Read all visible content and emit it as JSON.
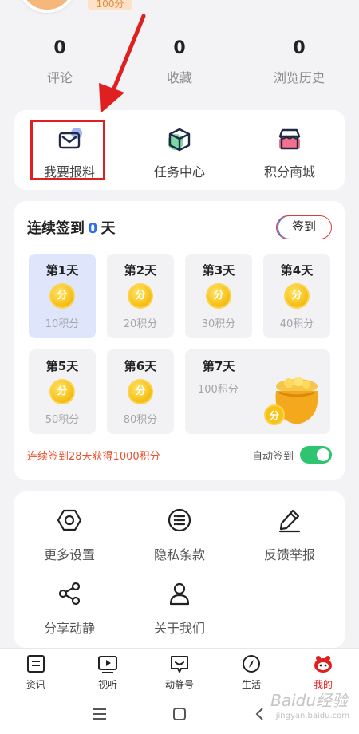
{
  "profile": {
    "points_badge": "100分"
  },
  "stats": [
    {
      "value": "0",
      "label": "评论"
    },
    {
      "value": "0",
      "label": "收藏"
    },
    {
      "value": "0",
      "label": "浏览历史"
    }
  ],
  "quick_actions": [
    {
      "label": "我要报料",
      "icon": "mail-icon"
    },
    {
      "label": "任务中心",
      "icon": "cube-icon"
    },
    {
      "label": "积分商城",
      "icon": "shop-icon"
    }
  ],
  "signin": {
    "title_prefix": "连续签到",
    "days": "0",
    "title_suffix": "天",
    "button": "签到",
    "coin_text": "分",
    "cards": [
      {
        "day": "第1天",
        "points": "10积分"
      },
      {
        "day": "第2天",
        "points": "20积分"
      },
      {
        "day": "第3天",
        "points": "30积分"
      },
      {
        "day": "第4天",
        "points": "40积分"
      },
      {
        "day": "第5天",
        "points": "50积分"
      },
      {
        "day": "第6天",
        "points": "80积分"
      },
      {
        "day": "第7天",
        "points": "100积分"
      }
    ],
    "streak_note": "连续签到28天获得1000积分",
    "auto_label": "自动签到"
  },
  "settings": [
    {
      "label": "更多设置",
      "icon": "hexagon-settings-icon"
    },
    {
      "label": "隐私条款",
      "icon": "list-circle-icon"
    },
    {
      "label": "反馈举报",
      "icon": "pen-icon"
    },
    {
      "label": "分享动静",
      "icon": "share-icon"
    },
    {
      "label": "关于我们",
      "icon": "person-icon"
    }
  ],
  "nav": [
    {
      "label": "资讯",
      "icon": "news-icon"
    },
    {
      "label": "视听",
      "icon": "play-icon"
    },
    {
      "label": "动静号",
      "icon": "smile-box-icon"
    },
    {
      "label": "生活",
      "icon": "compass-icon"
    },
    {
      "label": "我的",
      "icon": "mascot-icon"
    }
  ],
  "watermark": {
    "main": "Baidu经验",
    "sub": "jingyan.baidu.com"
  },
  "colors": {
    "accent_red": "#e02020",
    "blue": "#2f6fe6",
    "toggle_green": "#2fc46f"
  }
}
